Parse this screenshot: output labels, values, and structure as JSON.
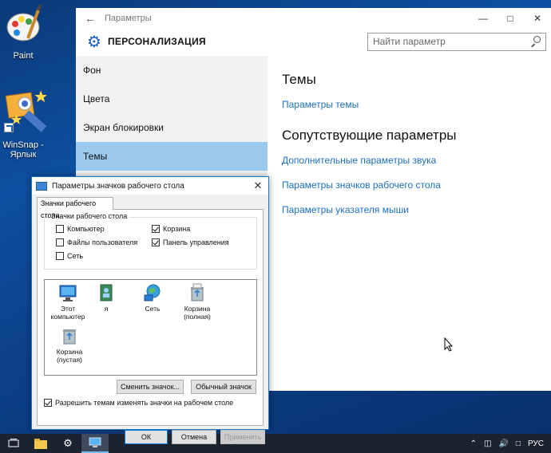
{
  "desktop": {
    "icons": [
      {
        "label": "Paint",
        "icon": "paint-palette-icon"
      },
      {
        "label": "WinSnap - Ярлык",
        "icon": "winsnap-icon"
      }
    ]
  },
  "settings": {
    "window_title": "Параметры",
    "section_title": "ПЕРСОНАЛИЗАЦИЯ",
    "search_placeholder": "Найти параметр",
    "nav_items": [
      {
        "label": "Фон"
      },
      {
        "label": "Цвета"
      },
      {
        "label": "Экран блокировки"
      },
      {
        "label": "Темы"
      }
    ],
    "content": {
      "themes_heading": "Темы",
      "themes_link": "Параметры темы",
      "related_heading": "Сопутствующие параметры",
      "related_links": [
        "Дополнительные параметры звука",
        "Параметры значков рабочего стола",
        "Параметры указателя мыши"
      ]
    }
  },
  "dialog": {
    "title": "Параметры значков рабочего стола",
    "tab_label": "Значки рабочего стола",
    "group_label": "Значки рабочего стола",
    "checkboxes": [
      {
        "label": "Компьютер",
        "checked": false
      },
      {
        "label": "Корзина",
        "checked": true
      },
      {
        "label": "Файлы пользователя",
        "checked": false
      },
      {
        "label": "Панель управления",
        "checked": true
      },
      {
        "label": "Сеть",
        "checked": false
      }
    ],
    "icons": [
      {
        "label": "Этот компьютер",
        "icon": "this-pc-icon"
      },
      {
        "label": "я",
        "icon": "user-folder-icon"
      },
      {
        "label": "Сеть",
        "icon": "network-icon"
      },
      {
        "label": "Корзина (полная)",
        "icon": "recycle-bin-full-icon"
      },
      {
        "label": "Корзина (пустая)",
        "icon": "recycle-bin-empty-icon"
      }
    ],
    "change_icon_button": "Сменить значок...",
    "default_icon_button": "Обычный значок",
    "allow_themes_checkbox": {
      "label": "Разрешить темам изменять значки на рабочем столе",
      "checked": true
    },
    "ok_button": "ОК",
    "cancel_button": "Отмена",
    "apply_button": "Применить"
  },
  "taskbar": {
    "language": "РУС"
  },
  "colors": {
    "accent": "#1a6fc0",
    "nav_selected": "#9cc9ee",
    "taskbar": "#1b2230"
  }
}
